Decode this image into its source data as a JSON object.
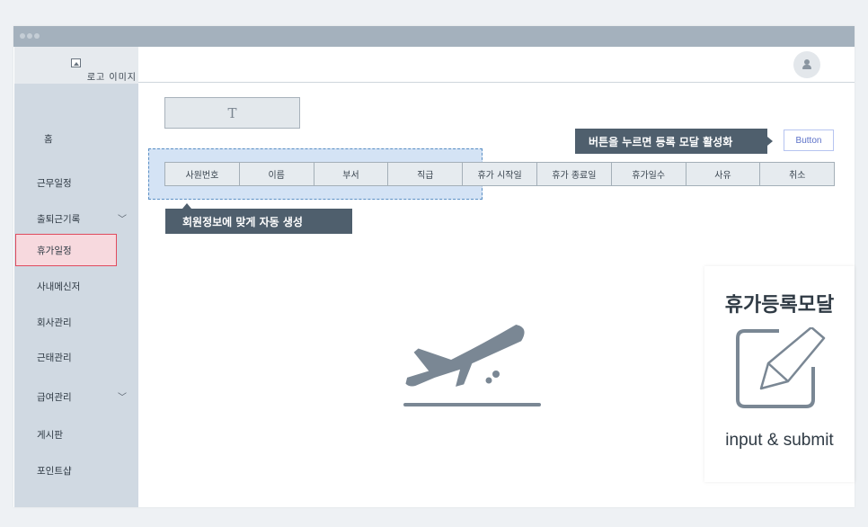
{
  "sidebar": {
    "logo_text": "로고 이미지",
    "items": [
      {
        "label": "홈"
      },
      {
        "label": "근무일정"
      },
      {
        "label": "출퇴근기록",
        "has_submenu": true
      },
      {
        "label": "휴가일정",
        "active": true
      },
      {
        "label": "사내메신저"
      },
      {
        "label": "회사관리"
      },
      {
        "label": "근태관리"
      },
      {
        "label": "급여관리",
        "has_submenu": true
      },
      {
        "label": "게시판"
      },
      {
        "label": "포인트샵"
      }
    ]
  },
  "header": {
    "avatar_icon": "user-icon"
  },
  "main": {
    "text_placeholder": "T",
    "button_tooltip": "버튼을 누르면 등록 모달 활성화",
    "button_label": "Button",
    "auto_tooltip": "회원정보에 맞게 자동 생성",
    "table_columns": [
      "사원번호",
      "이름",
      "부서",
      "직급",
      "휴가 시작일",
      "휴가 종료일",
      "휴가일수",
      "사유",
      "취소"
    ],
    "illustration_icon": "airplane-takeoff-icon",
    "modal": {
      "title": "휴가등록모달",
      "icon": "edit-icon",
      "subtitle": "input & submit"
    }
  },
  "colors": {
    "sidebar_bg": "#d0d9e2",
    "titlebar_bg": "#a4b1bd",
    "active_item_bg": "#f7d9de",
    "active_item_border": "#e04b5e",
    "tooltip_bg": "#4f5f6d",
    "button_text": "#5c71c8",
    "selection_bg": "#d4e3f5"
  }
}
